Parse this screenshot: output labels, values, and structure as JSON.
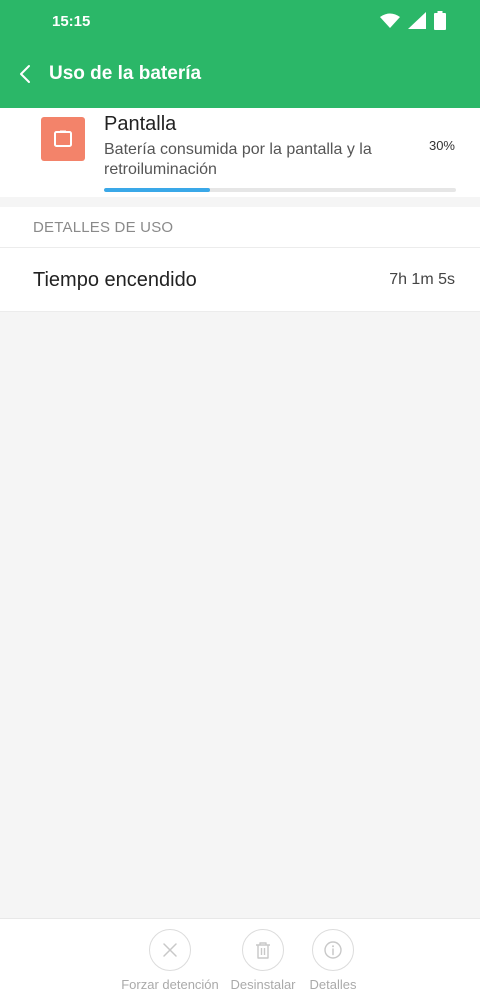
{
  "status_bar": {
    "time": "15:15"
  },
  "header": {
    "title": "Uso de la batería"
  },
  "summary": {
    "app_name": "Pantalla",
    "description": "Batería consumida por la pantalla y la retroiluminación",
    "percent_label": "30%",
    "progress_fraction": 0.3,
    "icon": "screen-icon",
    "icon_color": "#f3836a"
  },
  "section": {
    "title": "DETALLES DE USO"
  },
  "details": [
    {
      "label": "Tiempo encendido",
      "value": "7h 1m 5s"
    }
  ],
  "actions": [
    {
      "label": "Forzar detención",
      "icon": "close-icon"
    },
    {
      "label": "Desinstalar",
      "icon": "trash-icon"
    },
    {
      "label": "Detalles",
      "icon": "info-icon"
    }
  ],
  "colors": {
    "accent": "#2bb768",
    "progress": "#3aa8e8"
  }
}
